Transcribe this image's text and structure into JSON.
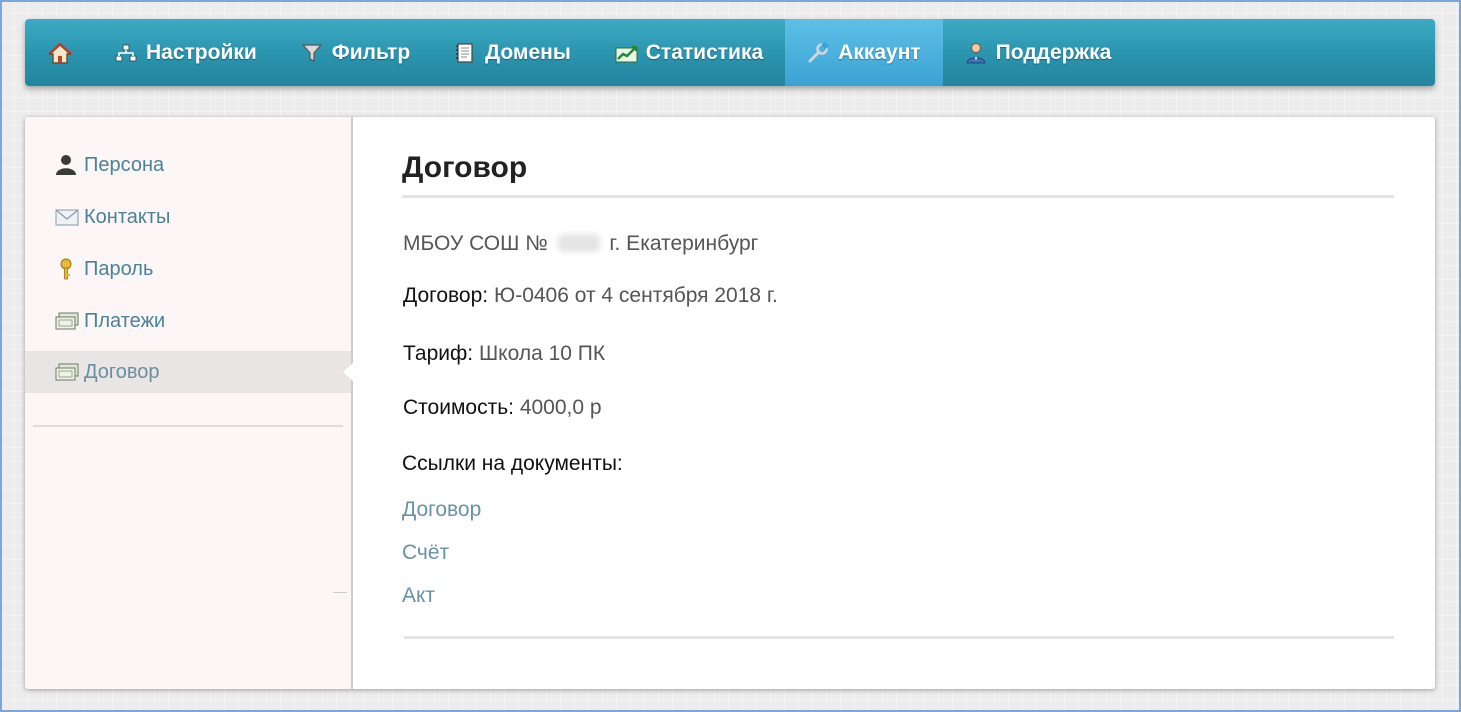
{
  "nav": {
    "home_icon": "home-icon",
    "items": [
      {
        "label": "Настройки",
        "icon": "sitemap-icon"
      },
      {
        "label": "Фильтр",
        "icon": "filter-icon"
      },
      {
        "label": "Домены",
        "icon": "notebook-icon"
      },
      {
        "label": "Статистика",
        "icon": "chart-icon"
      },
      {
        "label": "Аккаунт",
        "icon": "wrench-icon",
        "active": true
      },
      {
        "label": "Поддержка",
        "icon": "support-person-icon"
      }
    ]
  },
  "sidebar": {
    "items": [
      {
        "label": "Персона",
        "icon": "person-icon"
      },
      {
        "label": "Контакты",
        "icon": "envelope-icon"
      },
      {
        "label": "Пароль",
        "icon": "key-icon"
      },
      {
        "label": "Платежи",
        "icon": "money-icon"
      },
      {
        "label": "Договор",
        "icon": "money-icon",
        "active": true
      }
    ]
  },
  "content": {
    "title": "Договор",
    "org_prefix": "МБОУ СОШ №",
    "org_suffix": "г. Екатеринбург",
    "contract_label": "Договор:",
    "contract_value": "Ю-0406 от 4 сентября 2018 г.",
    "tariff_label": "Тариф:",
    "tariff_value": "Школа 10 ПК",
    "cost_label": "Стоимость:",
    "cost_value": "4000,0 р",
    "docs_heading": "Ссылки на документы:",
    "docs": [
      "Договор",
      "Счёт",
      "Акт"
    ]
  },
  "colors": {
    "nav_bg": "#2a93ad",
    "nav_active": "#3aa2d4",
    "link": "#6a92a6",
    "sidebar_link": "#4b8296"
  }
}
